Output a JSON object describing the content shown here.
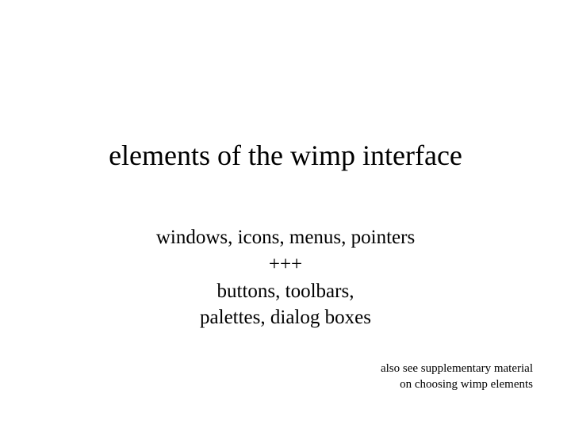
{
  "slide": {
    "title": "elements of the wimp interface",
    "body": {
      "line1": "windows, icons, menus, pointers",
      "line2": "+++",
      "line3": "buttons, toolbars,",
      "line4": "palettes, dialog boxes"
    },
    "footnote": {
      "line1": "also see supplementary  material",
      "line2": "on choosing wimp elements"
    }
  }
}
